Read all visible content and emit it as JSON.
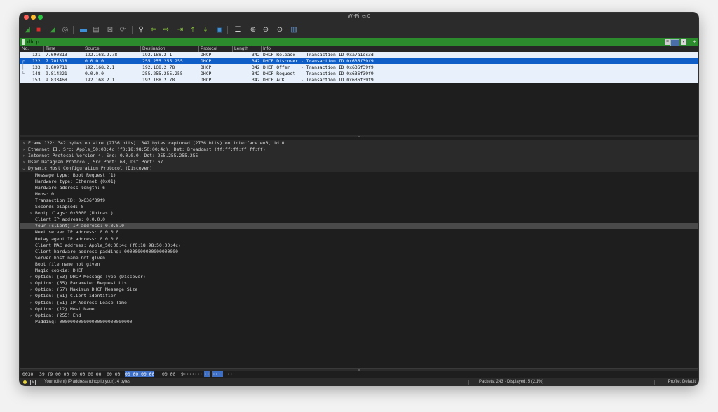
{
  "window": {
    "title": "Wi-Fi: en0"
  },
  "toolbar": {
    "buttons": [
      {
        "icon": "shark-fin-start-icon",
        "color": "#3c9a3c"
      },
      {
        "icon": "stop-square-icon",
        "color": "#e02a2a"
      },
      {
        "icon": "restart-fin-icon",
        "color": "#3c9a3c"
      },
      {
        "icon": "capture-options-gear-icon",
        "color": "#9a9a9a"
      },
      {
        "icon": "open-folder-icon",
        "color": "#3f8fd6"
      },
      {
        "icon": "save-file-icon",
        "color": "#9a9a9a"
      },
      {
        "icon": "close-file-icon",
        "color": "#9a9a9a"
      },
      {
        "icon": "reload-file-icon",
        "color": "#9a9a9a"
      },
      {
        "icon": "find-packet-icon",
        "color": "#cfcfcf"
      },
      {
        "icon": "go-back-arrow-icon",
        "color": "#8fd13a"
      },
      {
        "icon": "go-forward-arrow-icon",
        "color": "#8fd13a"
      },
      {
        "icon": "go-to-packet-icon",
        "color": "#8fd13a"
      },
      {
        "icon": "go-to-first-icon",
        "color": "#8fd13a"
      },
      {
        "icon": "go-to-last-icon",
        "color": "#8fd13a"
      },
      {
        "icon": "autoscroll-icon",
        "color": "#3f8fd6"
      },
      {
        "icon": "colorize-icon",
        "color": "#cfcfcf"
      },
      {
        "icon": "zoom-in-icon",
        "color": "#cfcfcf"
      },
      {
        "icon": "zoom-out-icon",
        "color": "#cfcfcf"
      },
      {
        "icon": "zoom-normal-icon",
        "color": "#cfcfcf"
      },
      {
        "icon": "resize-columns-icon",
        "color": "#6aa0e0"
      }
    ]
  },
  "filter": {
    "value": "dhcp",
    "bg_color": "#2c8b2c"
  },
  "packet_list": {
    "columns": [
      "No.",
      "Time",
      "Source",
      "Destination",
      "Protocol",
      "Length",
      "Info"
    ],
    "rows": [
      {
        "no": "121",
        "time": "7.690813",
        "source": "192.168.2.78",
        "destination": "192.168.2.1",
        "protocol": "DHCP",
        "length": "342",
        "info": "DHCP Release  - Transaction ID 0xa7a1ec3d",
        "rel": "",
        "selected": false
      },
      {
        "no": "122",
        "time": "7.701318",
        "source": "0.0.0.0",
        "destination": "255.255.255.255",
        "protocol": "DHCP",
        "length": "342",
        "info": "DHCP Discover - Transaction ID 0x636f39f9",
        "rel": "┌",
        "selected": true
      },
      {
        "no": "133",
        "time": "8.809711",
        "source": "192.168.2.1",
        "destination": "192.168.2.78",
        "protocol": "DHCP",
        "length": "342",
        "info": "DHCP Offer    - Transaction ID 0x636f39f9",
        "rel": "│",
        "selected": false
      },
      {
        "no": "148",
        "time": "9.814221",
        "source": "0.0.0.0",
        "destination": "255.255.255.255",
        "protocol": "DHCP",
        "length": "342",
        "info": "DHCP Request  - Transaction ID 0x636f39f9",
        "rel": "└",
        "selected": false
      },
      {
        "no": "153",
        "time": "9.833468",
        "source": "192.168.2.1",
        "destination": "192.168.2.78",
        "protocol": "DHCP",
        "length": "342",
        "info": "DHCP ACK      - Transaction ID 0x636f39f9",
        "rel": "",
        "selected": false
      }
    ],
    "row_color": "#e8f1fb",
    "selected_color": "#0f5ec7"
  },
  "details": [
    {
      "text": "Frame 122: 342 bytes on wire (2736 bits), 342 bytes captured (2736 bits) on interface en0, id 0",
      "level": 0,
      "arrow": "›",
      "top": true
    },
    {
      "text": "Ethernet II, Src: Apple_50:00:4c (f0:18:98:50:00:4c), Dst: Broadcast (ff:ff:ff:ff:ff:ff)",
      "level": 0,
      "arrow": "›",
      "top": true
    },
    {
      "text": "Internet Protocol Version 4, Src: 0.0.0.0, Dst: 255.255.255.255",
      "level": 0,
      "arrow": "›",
      "top": true
    },
    {
      "text": "User Datagram Protocol, Src Port: 68, Dst Port: 67",
      "level": 0,
      "arrow": "›",
      "top": true
    },
    {
      "text": "Dynamic Host Configuration Protocol (Discover)",
      "level": 0,
      "arrow": "⌄",
      "top": true
    },
    {
      "text": "Message type: Boot Request (1)",
      "level": 1,
      "arrow": ""
    },
    {
      "text": "Hardware type: Ethernet (0x01)",
      "level": 1,
      "arrow": ""
    },
    {
      "text": "Hardware address length: 6",
      "level": 1,
      "arrow": ""
    },
    {
      "text": "Hops: 0",
      "level": 1,
      "arrow": ""
    },
    {
      "text": "Transaction ID: 0x636f39f9",
      "level": 1,
      "arrow": ""
    },
    {
      "text": "Seconds elapsed: 0",
      "level": 1,
      "arrow": ""
    },
    {
      "text": "Bootp flags: 0x0000 (Unicast)",
      "level": 1,
      "arrow": "›"
    },
    {
      "text": "Client IP address: 0.0.0.0",
      "level": 1,
      "arrow": ""
    },
    {
      "text": "Your (client) IP address: 0.0.0.0",
      "level": 1,
      "arrow": "",
      "highlighted": true
    },
    {
      "text": "Next server IP address: 0.0.0.0",
      "level": 1,
      "arrow": ""
    },
    {
      "text": "Relay agent IP address: 0.0.0.0",
      "level": 1,
      "arrow": ""
    },
    {
      "text": "Client MAC address: Apple_50:00:4c (f0:18:98:50:00:4c)",
      "level": 1,
      "arrow": ""
    },
    {
      "text": "Client hardware address padding: 00000000000000000000",
      "level": 1,
      "arrow": ""
    },
    {
      "text": "Server host name not given",
      "level": 1,
      "arrow": ""
    },
    {
      "text": "Boot file name not given",
      "level": 1,
      "arrow": ""
    },
    {
      "text": "Magic cookie: DHCP",
      "level": 1,
      "arrow": ""
    },
    {
      "text": "Option: (53) DHCP Message Type (Discover)",
      "level": 1,
      "arrow": "›"
    },
    {
      "text": "Option: (55) Parameter Request List",
      "level": 1,
      "arrow": "›"
    },
    {
      "text": "Option: (57) Maximum DHCP Message Size",
      "level": 1,
      "arrow": "›"
    },
    {
      "text": "Option: (61) Client identifier",
      "level": 1,
      "arrow": "›"
    },
    {
      "text": "Option: (51) IP Address Lease Time",
      "level": 1,
      "arrow": "›"
    },
    {
      "text": "Option: (12) Host Name",
      "level": 1,
      "arrow": "›"
    },
    {
      "text": "Option: (255) End",
      "level": 1,
      "arrow": "›"
    },
    {
      "text": "Padding: 000000000000000000000000000",
      "level": 1,
      "arrow": ""
    }
  ],
  "hex": {
    "offset": "0030",
    "bytes_before": "39 f9 00 00 00 00 00 00  00 00",
    "bytes_highlight": "00 00 00 00",
    "bytes_after": "00 00",
    "ascii_before": "9·······",
    "ascii_highlight": "··",
    "ascii_highlight2": "····",
    "ascii_after": "··"
  },
  "status": {
    "field": "Your (client) IP address (dhcp.ip.your), 4 bytes",
    "packets": "Packets: 243 · Displayed: 5 (2.1%)",
    "profile": "Profile: Default"
  }
}
